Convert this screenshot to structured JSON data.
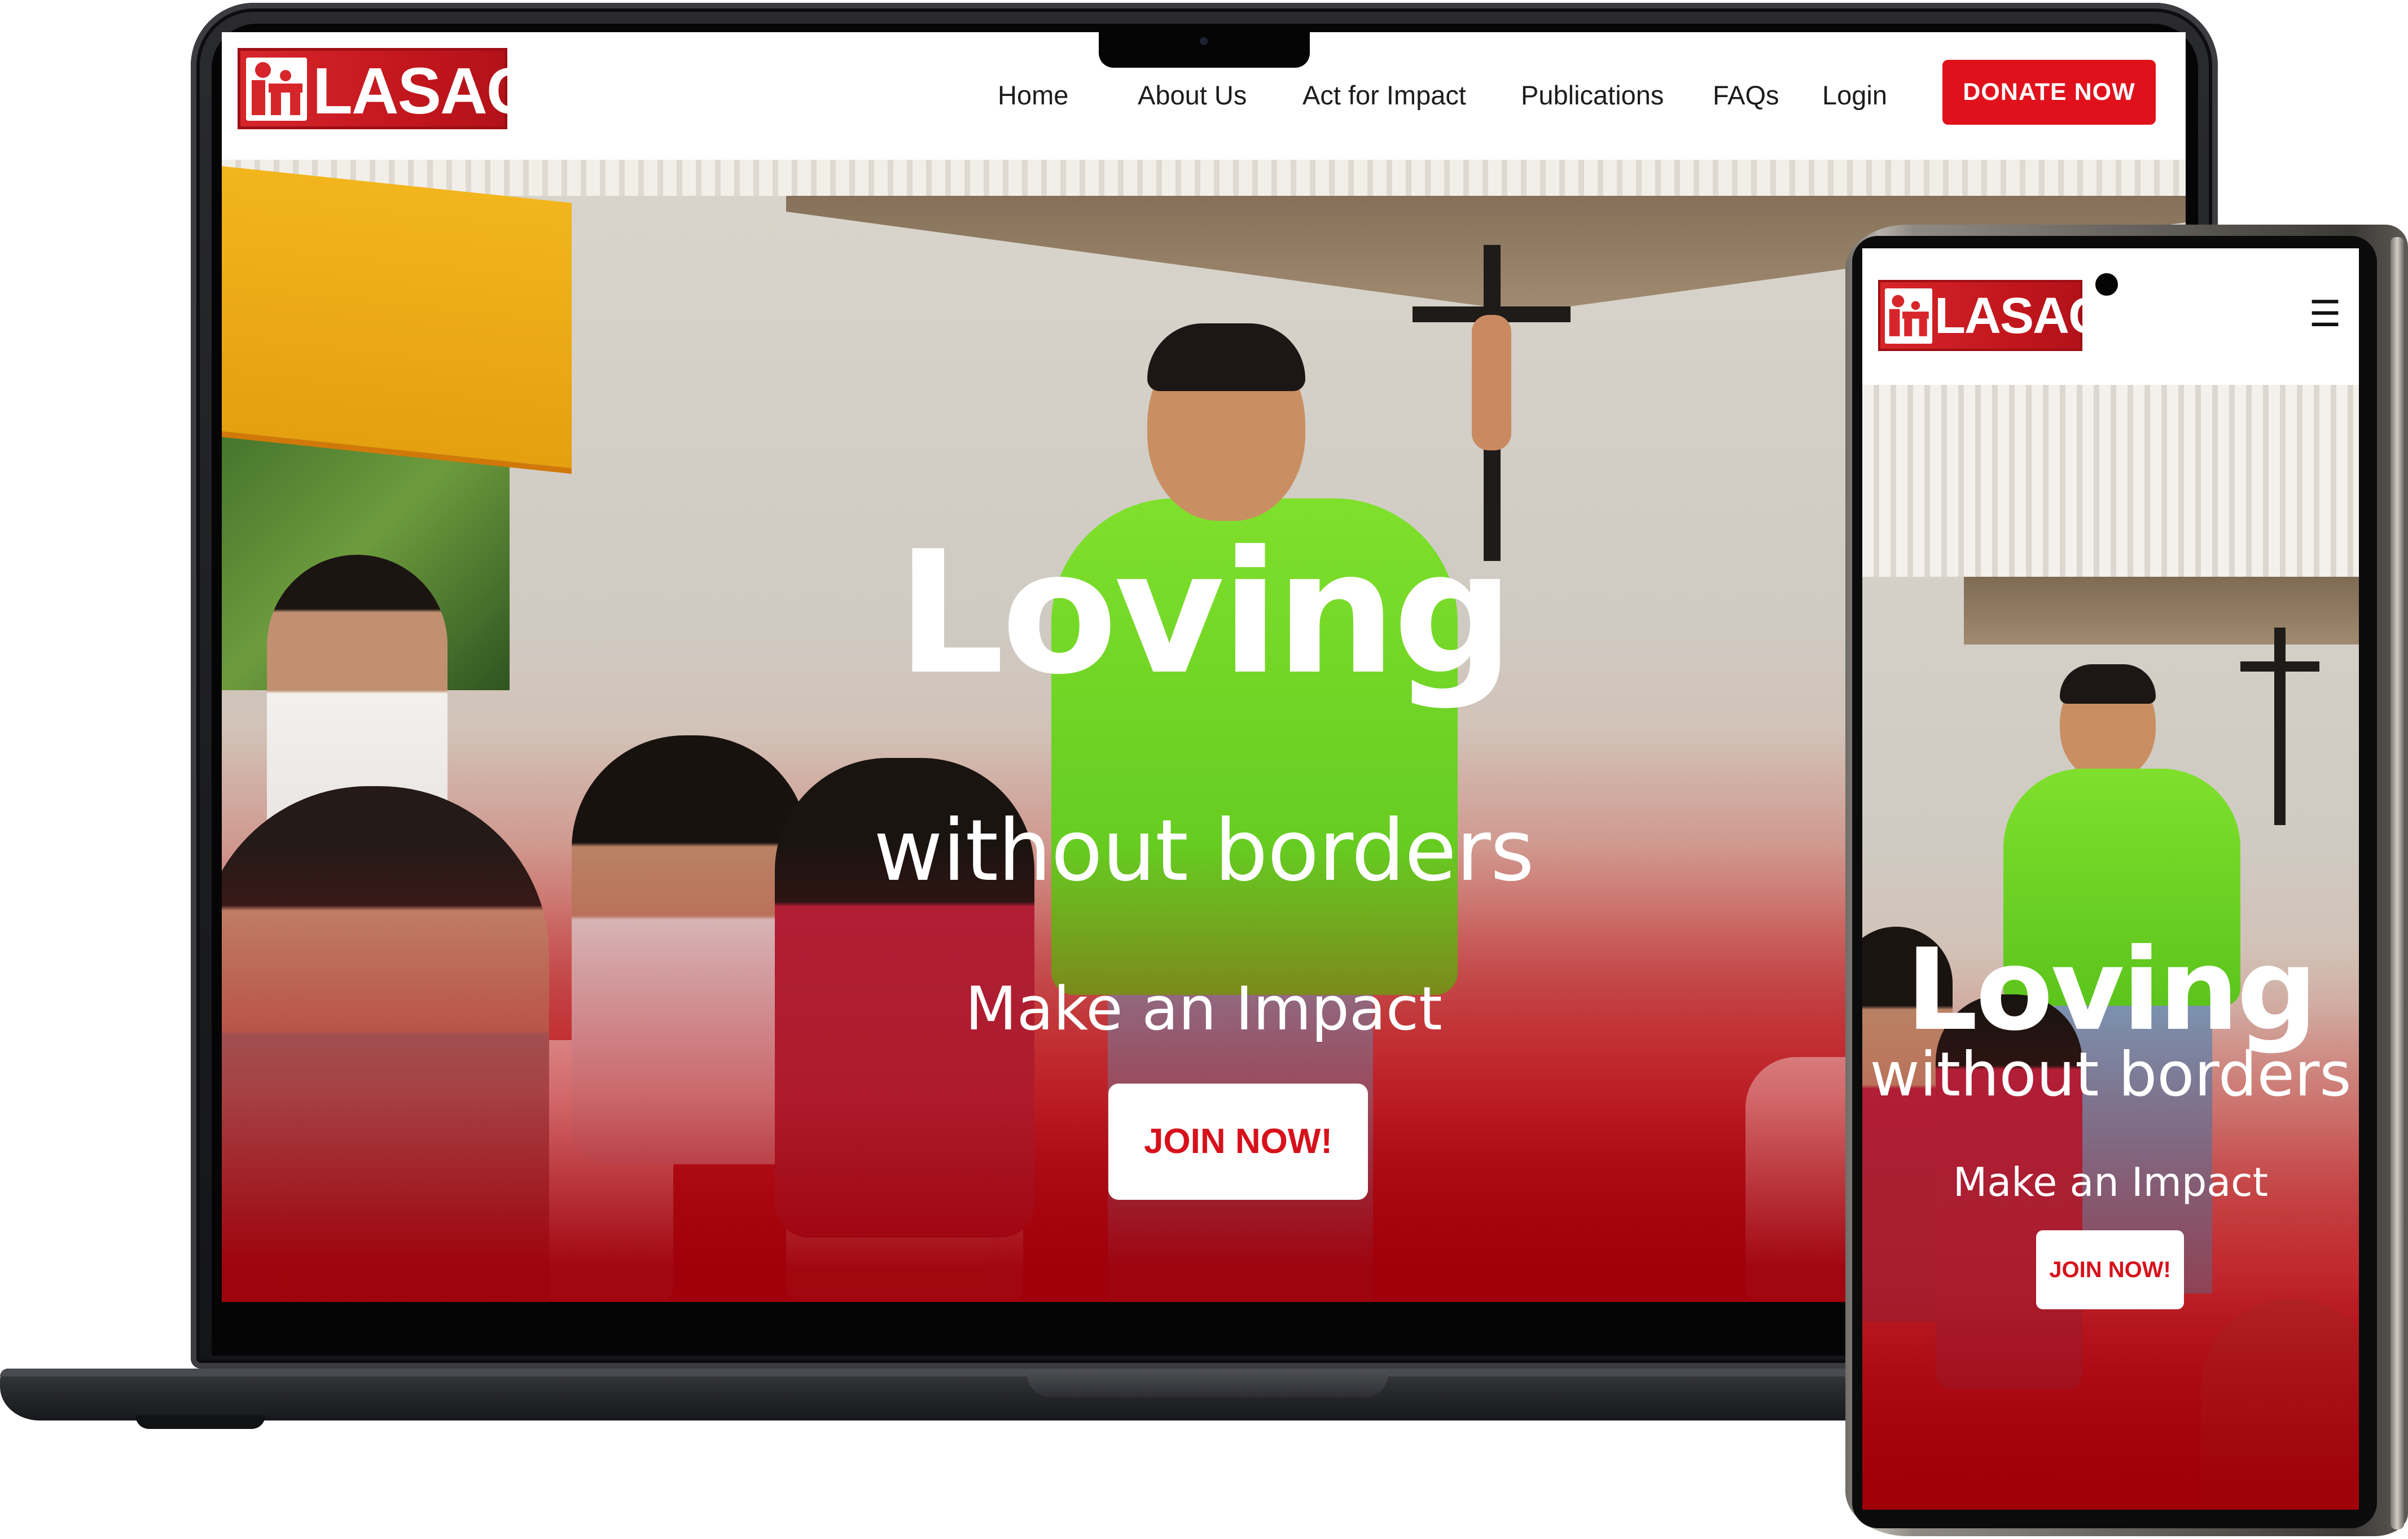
{
  "brand": {
    "name": "LASAC",
    "colors": {
      "primary_red": "#e0111b",
      "dark_red": "#a2000a",
      "white": "#ffffff"
    }
  },
  "desktop": {
    "nav": {
      "items": [
        {
          "label": "Home"
        },
        {
          "label": "About Us"
        },
        {
          "label": "Act for Impact"
        },
        {
          "label": "Publications"
        },
        {
          "label": "FAQs"
        },
        {
          "label": "Login"
        }
      ],
      "donate_label": "DONATE NOW"
    },
    "hero": {
      "headline": "Loving",
      "subheadline": "without borders",
      "tagline": "Make an Impact",
      "cta_label": "JOIN NOW!"
    }
  },
  "mobile": {
    "menu_icon": "hamburger-icon",
    "menu_glyph": "☰",
    "hero": {
      "headline": "Loving",
      "subheadline": "without borders",
      "tagline": "Make an Impact",
      "cta_label": "JOIN NOW!"
    }
  }
}
